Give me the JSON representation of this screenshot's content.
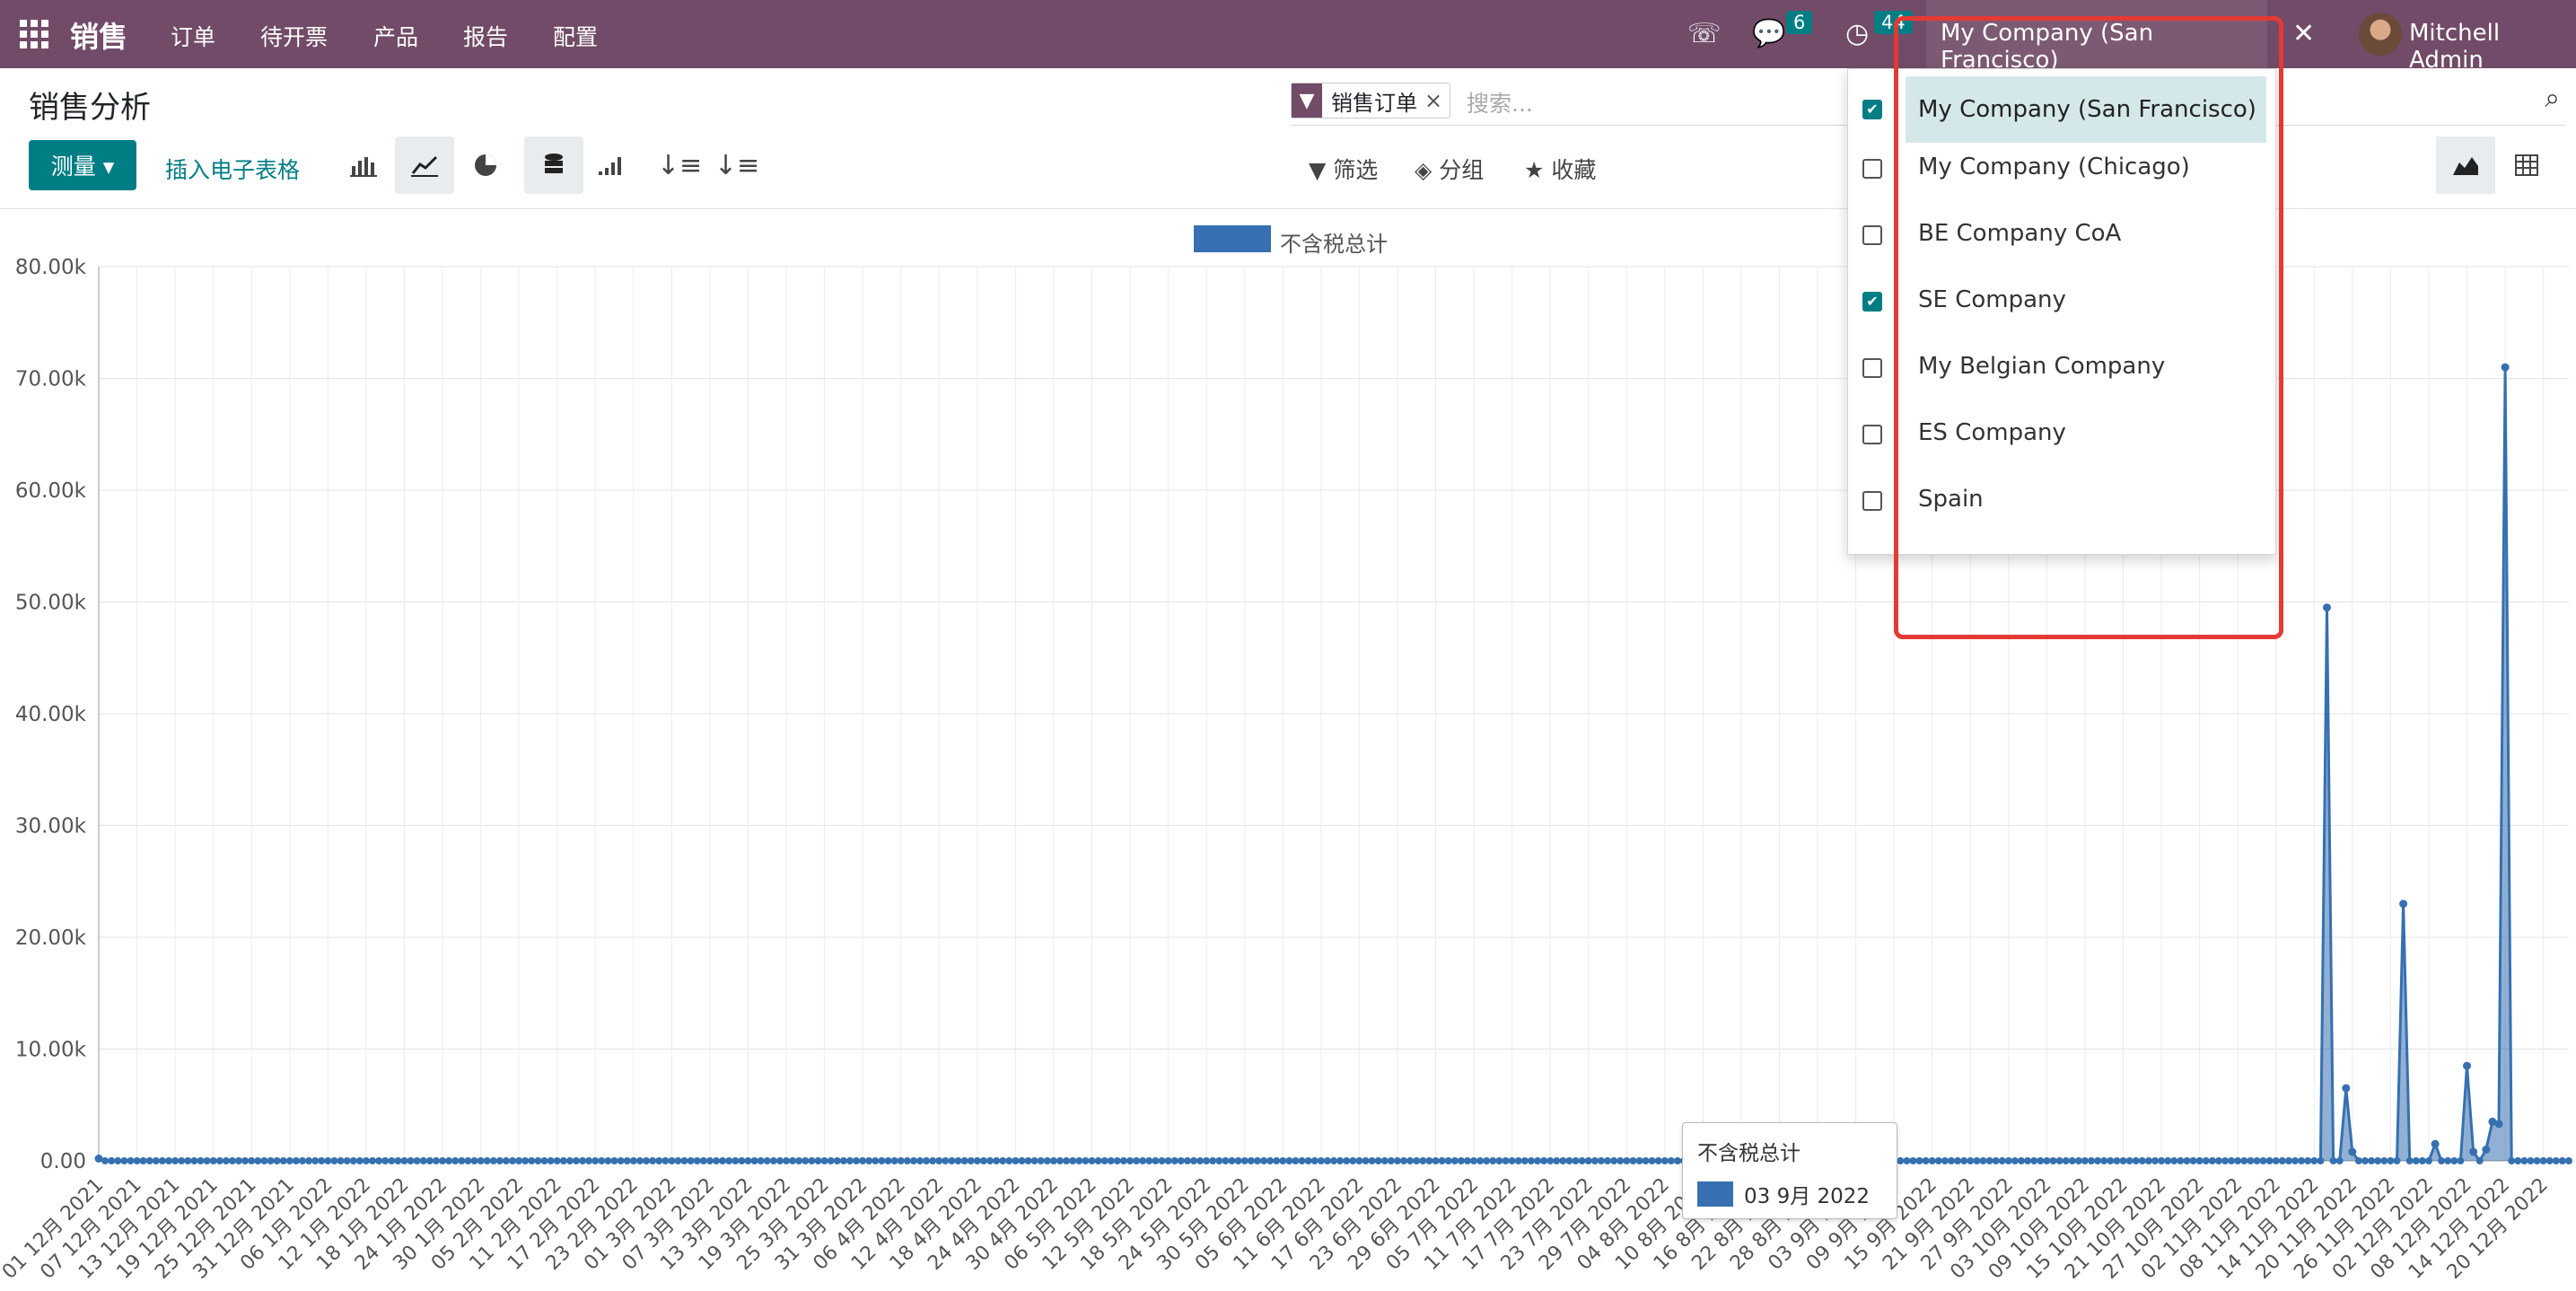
{
  "navbar": {
    "brand": "销售",
    "menu": [
      "订单",
      "待开票",
      "产品",
      "报告",
      "配置"
    ],
    "messages_badge": "6",
    "activities_badge": "44",
    "current_company": "My Company (San Francisco)",
    "user_name": "Mitchell Admin"
  },
  "control_panel": {
    "title": "销售分析",
    "facet_label": "销售订单",
    "facet_close": "×",
    "search_placeholder": "搜索...",
    "measure_label": "测量 ▾",
    "insert_spreadsheet": "插入电子表格",
    "filters_label": "筛选",
    "groupby_label": "分组",
    "favorites_label": "收藏"
  },
  "company_dropdown": {
    "items": [
      {
        "label": "My Company (San Francisco)",
        "checked": true,
        "current": true
      },
      {
        "label": "My Company (Chicago)",
        "checked": false
      },
      {
        "label": "BE Company CoA",
        "checked": false
      },
      {
        "label": "SE Company",
        "checked": true
      },
      {
        "label": "My Belgian Company",
        "checked": false
      },
      {
        "label": "ES Company",
        "checked": false
      },
      {
        "label": "Spain",
        "checked": false
      }
    ]
  },
  "tooltip": {
    "title": "不含税总计",
    "date": "03 9月 2022"
  },
  "chart_data": {
    "type": "line",
    "legend": [
      "不含税总计"
    ],
    "ylim": [
      0,
      80000
    ],
    "y_ticks": [
      "0.00",
      "10.00k",
      "20.00k",
      "30.00k",
      "40.00k",
      "50.00k",
      "60.00k",
      "70.00k",
      "80.00k"
    ],
    "x_labels": [
      "01 12月 2021",
      "07 12月 2021",
      "13 12月 2021",
      "19 12月 2021",
      "25 12月 2021",
      "31 12月 2021",
      "06 1月 2022",
      "12 1月 2022",
      "18 1月 2022",
      "24 1月 2022",
      "30 1月 2022",
      "05 2月 2022",
      "11 2月 2022",
      "17 2月 2022",
      "23 2月 2022",
      "01 3月 2022",
      "07 3月 2022",
      "13 3月 2022",
      "19 3月 2022",
      "25 3月 2022",
      "31 3月 2022",
      "06 4月 2022",
      "12 4月 2022",
      "18 4月 2022",
      "24 4月 2022",
      "30 4月 2022",
      "06 5月 2022",
      "12 5月 2022",
      "18 5月 2022",
      "24 5月 2022",
      "30 5月 2022",
      "05 6月 2022",
      "11 6月 2022",
      "17 6月 2022",
      "23 6月 2022",
      "29 6月 2022",
      "05 7月 2022",
      "11 7月 2022",
      "17 7月 2022",
      "23 7月 2022",
      "29 7月 2022",
      "04 8月 2022",
      "10 8月 2022",
      "16 8月 2022",
      "22 8月 2022",
      "28 8月 2022",
      "03 9月 2022",
      "09 9月 2022",
      "15 9月 2022",
      "21 9月 2022",
      "27 9月 2022",
      "03 10月 2022",
      "09 10月 2022",
      "15 10月 2022",
      "21 10月 2022",
      "27 10月 2022",
      "02 11月 2022",
      "08 11月 2022",
      "14 11月 2022",
      "20 11月 2022",
      "26 11月 2022",
      "02 12月 2022",
      "08 12月 2022",
      "14 12月 2022",
      "20 12月 2022"
    ],
    "peaks": [
      {
        "date": "16 11月 2022",
        "value": 49500
      },
      {
        "date": "19 11月 2022",
        "value": 6500
      },
      {
        "date": "20 11月 2022",
        "value": 800
      },
      {
        "date": "28 11月 2022",
        "value": 23000
      },
      {
        "date": "03 12月 2022",
        "value": 1500
      },
      {
        "date": "08 12月 2022",
        "value": 8500
      },
      {
        "date": "09 12月 2022",
        "value": 800
      },
      {
        "date": "11 12月 2022",
        "value": 1000
      },
      {
        "date": "12 12月 2022",
        "value": 3500
      },
      {
        "date": "13 12月 2022",
        "value": 3300
      },
      {
        "date": "14 12月 2022",
        "value": 71000
      }
    ]
  }
}
